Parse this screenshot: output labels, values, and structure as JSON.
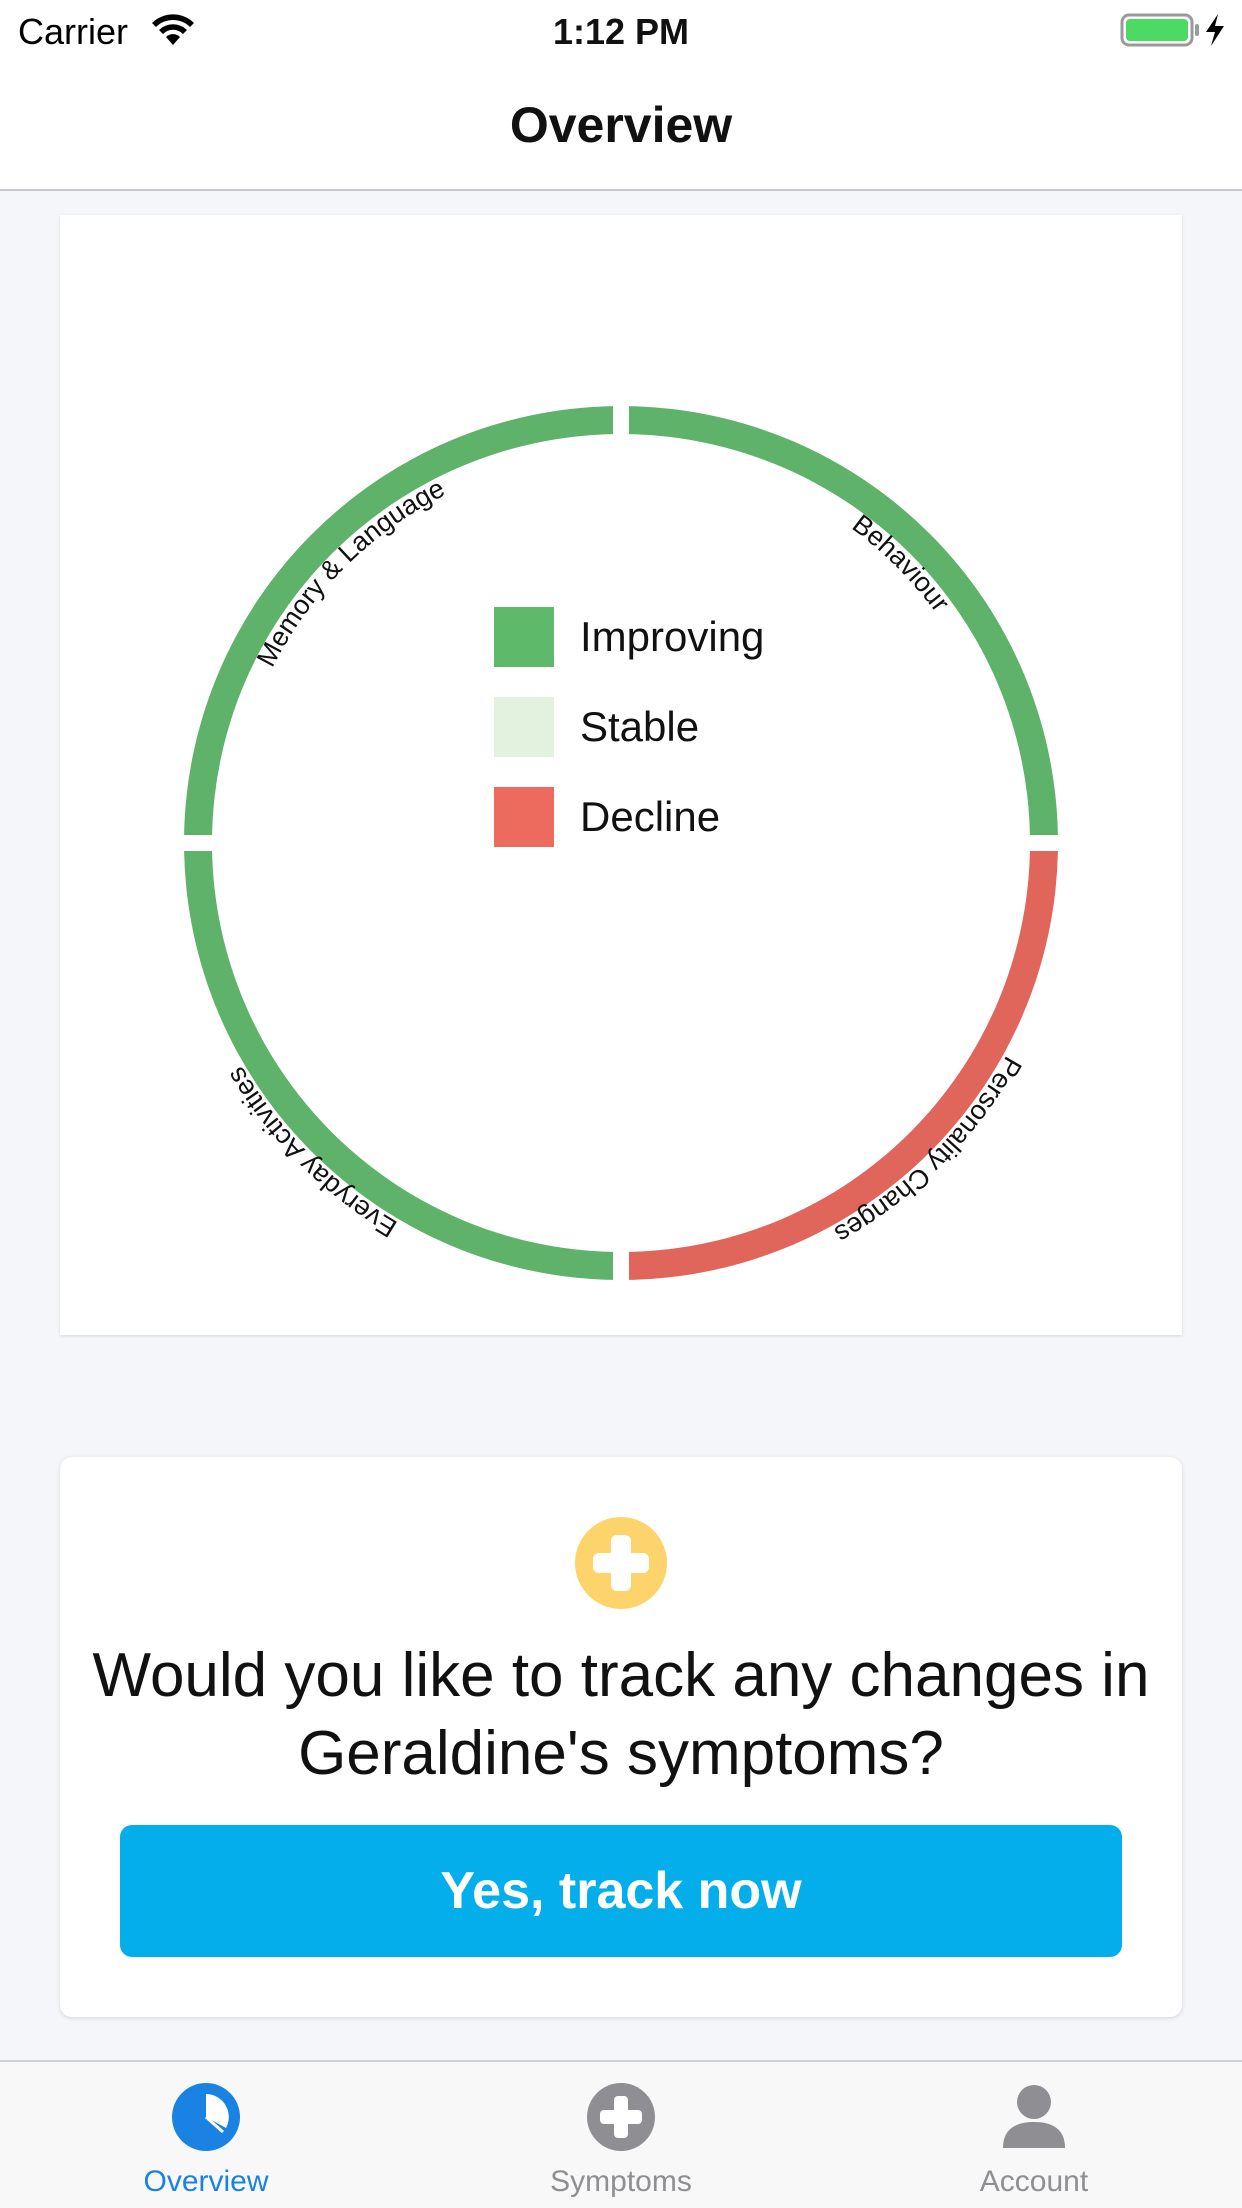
{
  "status_bar": {
    "carrier": "Carrier",
    "time": "1:12 PM"
  },
  "nav": {
    "title": "Overview"
  },
  "chart": {
    "colors": {
      "improving": "#5fb26a",
      "stable": "#e3f2df",
      "decline": "#e0665b"
    },
    "segments": [
      {
        "label": "Behaviour",
        "status": "improving"
      },
      {
        "label": "Personality Changes",
        "status": "decline"
      },
      {
        "label": "Everyday Activities",
        "status": "improving"
      },
      {
        "label": "Memory & Language",
        "status": "improving"
      }
    ],
    "legend": [
      {
        "label": "Improving",
        "color": "#5fb96b"
      },
      {
        "label": "Stable",
        "color": "#e3f2df"
      },
      {
        "label": "Decline",
        "color": "#ec6b5e"
      }
    ]
  },
  "cta": {
    "question": "Would you like to track any changes in Geraldine's symptoms?",
    "button": "Yes, track now",
    "icon": "plus-icon",
    "icon_color": "#fdd46b"
  },
  "tabs": [
    {
      "label": "Overview",
      "icon": "pie-chart-icon",
      "active": true
    },
    {
      "label": "Symptoms",
      "icon": "plus-circle-icon",
      "active": false
    },
    {
      "label": "Account",
      "icon": "person-icon",
      "active": false
    }
  ],
  "theme": {
    "accent_blue": "#1a82e2",
    "button_blue": "#03aeeb"
  }
}
